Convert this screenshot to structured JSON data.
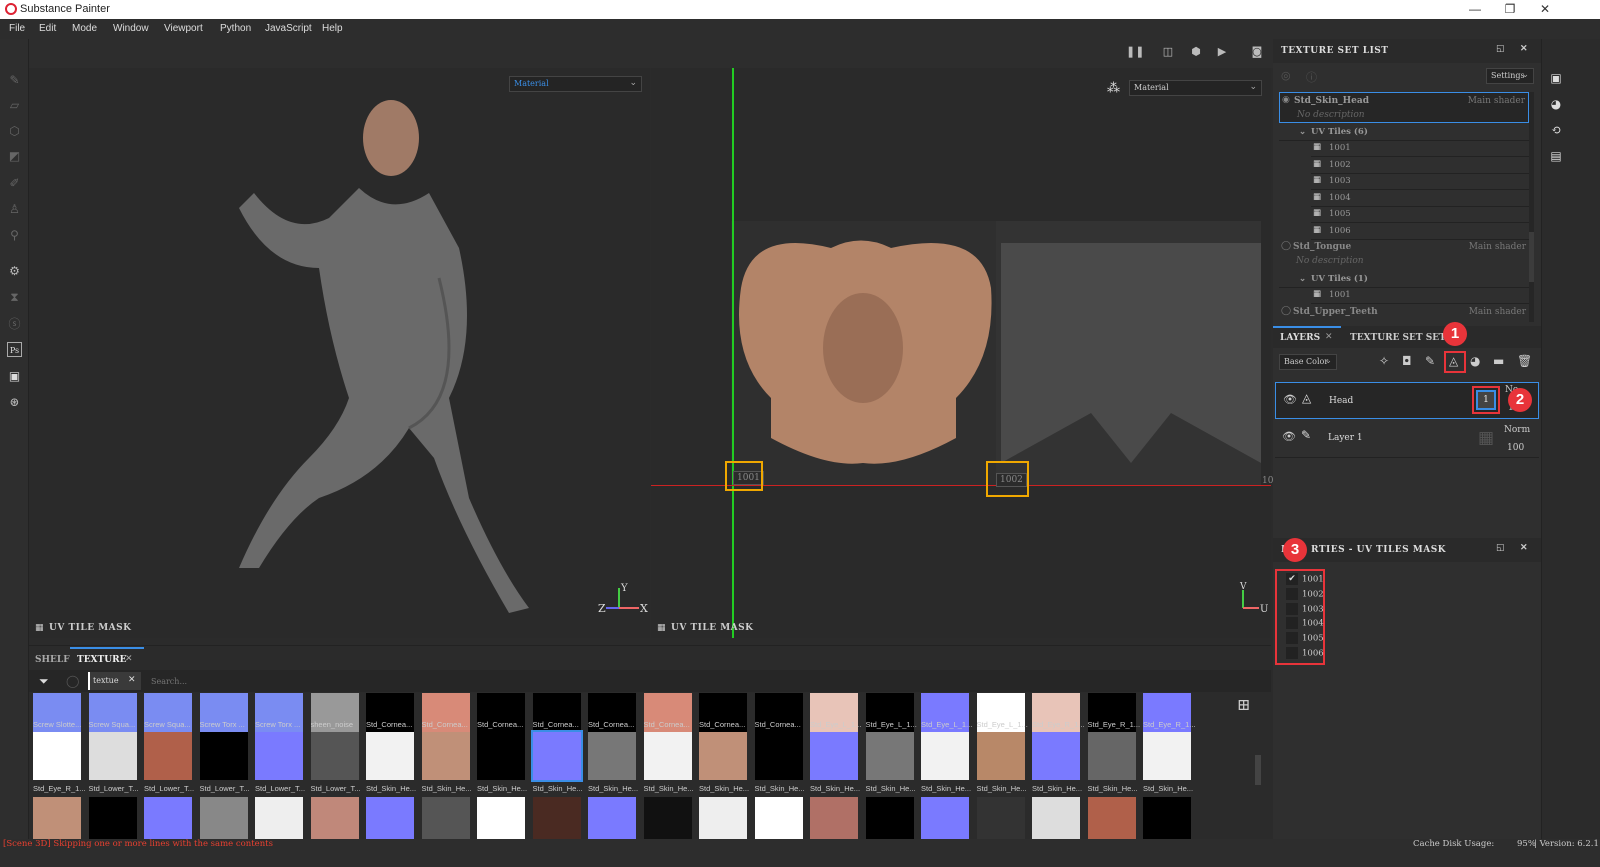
{
  "app": {
    "title": "Substance Painter"
  },
  "window_controls": {
    "minimize": "—",
    "restore": "❐",
    "close": "✕"
  },
  "menu": [
    "File",
    "Edit",
    "Mode",
    "Window",
    "Viewport",
    "Python",
    "JavaScript",
    "Help"
  ],
  "left_tools": [
    "paint-brush",
    "eraser",
    "projection",
    "polygon-fill",
    "smudge",
    "clone-stamp",
    "color-picker",
    "bake",
    "hourglass",
    "substance",
    "photoshop",
    "export",
    "plugin"
  ],
  "viewport_3d": {
    "dropdown_value": "Material",
    "axis_labels": {
      "x": "X",
      "y": "Y",
      "z": "Z"
    },
    "bottom_label": "UV TILE MASK"
  },
  "viewport_2d": {
    "dropdown_value": "Material",
    "tile_labels": [
      "1001",
      "1002"
    ],
    "axis_labels": {
      "u": "U",
      "v": "V"
    },
    "bottom_label": "UV TILE MASK",
    "edge_label": "10"
  },
  "texture_set_list": {
    "title": "TEXTURE SET LIST",
    "settings_label": "Settings",
    "sets": [
      {
        "name": "Std_Skin_Head",
        "shader": "Main shader",
        "description": "No description",
        "uv_header": "UV Tiles (6)",
        "tiles": [
          "1001",
          "1002",
          "1003",
          "1004",
          "1005",
          "1006"
        ],
        "selected": true
      },
      {
        "name": "Std_Tongue",
        "shader": "Main shader",
        "description": "No description",
        "uv_header": "UV Tiles (1)",
        "tiles": [
          "1001"
        ]
      },
      {
        "name": "Std_Upper_Teeth",
        "shader": "Main shader"
      }
    ]
  },
  "layers_panel": {
    "tabs": [
      "LAYERS",
      "TEXTURE SET SETTI"
    ],
    "channel": "Base Color",
    "layers": [
      {
        "name": "Head",
        "blend": "No",
        "opacity": "10",
        "mask_number": "1",
        "selected": true
      },
      {
        "name": "Layer 1",
        "blend": "Norm",
        "opacity": "100"
      }
    ]
  },
  "properties_panel": {
    "title": "PROPERTIES - UV TILES MASK",
    "title_visible": "RTIES - UV TILES MASK",
    "title_prefix": "P",
    "tiles": [
      {
        "label": "1001",
        "checked": true
      },
      {
        "label": "1002",
        "checked": false
      },
      {
        "label": "1003",
        "checked": false
      },
      {
        "label": "1004",
        "checked": false
      },
      {
        "label": "1005",
        "checked": false
      },
      {
        "label": "1006",
        "checked": false
      }
    ]
  },
  "annotations": [
    "1",
    "2",
    "3"
  ],
  "shelf": {
    "tabs": [
      "SHELF",
      "TEXTURE"
    ],
    "filter_tag": "textue",
    "search_placeholder": "Search...",
    "row1": [
      {
        "name": "Screw Slotte...",
        "color": "#7a8cf2"
      },
      {
        "name": "Screw Squa...",
        "color": "#7a8cf2"
      },
      {
        "name": "Screw Squa...",
        "color": "#7a8cf2"
      },
      {
        "name": "Screw Torx ...",
        "color": "#7a8cf2"
      },
      {
        "name": "Screw Torx ...",
        "color": "#7a8cf2"
      },
      {
        "name": "sheen_noise",
        "color": "#999999"
      },
      {
        "name": "Std_Cornea...",
        "color": "#000000"
      },
      {
        "name": "Std_Cornea...",
        "color": "#d88a78"
      },
      {
        "name": "Std_Cornea...",
        "color": "#000000"
      },
      {
        "name": "Std_Cornea...",
        "color": "#000000"
      },
      {
        "name": "Std_Cornea...",
        "color": "#000000"
      },
      {
        "name": "Std_Cornea...",
        "color": "#d88a78"
      },
      {
        "name": "Std_Cornea...",
        "color": "#000000"
      },
      {
        "name": "Std_Cornea...",
        "color": "#000000"
      },
      {
        "name": "Std_Eye_L_1...",
        "color": "#e8c4b8"
      },
      {
        "name": "Std_Eye_L_1...",
        "color": "#000000"
      },
      {
        "name": "Std_Eye_L_1...",
        "color": "#7a7aff"
      },
      {
        "name": "Std_Eye_L_1...",
        "color": "#ffffff"
      },
      {
        "name": "Std_Eye_R_1...",
        "color": "#e8c4b8"
      },
      {
        "name": "Std_Eye_R_1...",
        "color": "#000000"
      },
      {
        "name": "Std_Eye_R_1...",
        "color": "#7a7aff"
      }
    ],
    "row2": [
      {
        "name": "Std_Eye_R_1...",
        "color": "#ffffff"
      },
      {
        "name": "Std_Lower_T...",
        "color": "#dddddd"
      },
      {
        "name": "Std_Lower_T...",
        "color": "#b0604a"
      },
      {
        "name": "Std_Lower_T...",
        "color": "#000000"
      },
      {
        "name": "Std_Lower_T...",
        "color": "#7a7aff"
      },
      {
        "name": "Std_Lower_T...",
        "color": "#555555"
      },
      {
        "name": "Std_Skin_He...",
        "color": "#f2f2f2"
      },
      {
        "name": "Std_Skin_He...",
        "color": "#c09078"
      },
      {
        "name": "Std_Skin_He...",
        "color": "#000000"
      },
      {
        "name": "Std_Skin_He...",
        "color": "#7a7aff",
        "selected": true
      },
      {
        "name": "Std_Skin_He...",
        "color": "#777777"
      },
      {
        "name": "Std_Skin_He...",
        "color": "#f2f2f2"
      },
      {
        "name": "Std_Skin_He...",
        "color": "#c09078"
      },
      {
        "name": "Std_Skin_He...",
        "color": "#000000"
      },
      {
        "name": "Std_Skin_He...",
        "color": "#7a7aff"
      },
      {
        "name": "Std_Skin_He...",
        "color": "#777777"
      },
      {
        "name": "Std_Skin_He...",
        "color": "#f2f2f2"
      },
      {
        "name": "Std_Skin_He...",
        "color": "#b88868"
      },
      {
        "name": "Std_Skin_He...",
        "color": "#7a7aff"
      },
      {
        "name": "Std_Skin_He...",
        "color": "#666666"
      },
      {
        "name": "Std_Skin_He...",
        "color": "#f2f2f2"
      }
    ],
    "row3_colors": [
      "#c09078",
      "#000000",
      "#7a7aff",
      "#888888",
      "#eeeeee",
      "#c0887a",
      "#7a7aff",
      "#555555",
      "#ffffff",
      "#4a2a22",
      "#7a7aff",
      "#111111",
      "#eeeeee",
      "#ffffff",
      "#b07066",
      "#000000",
      "#7a7aff",
      "#333333",
      "#dddddd",
      "#b0604a",
      "#000000"
    ]
  },
  "status": {
    "message": "[Scene 3D] Skipping one or more lines with the same contents",
    "cache": "Cache Disk Usage:",
    "cache_value": "95%",
    "version": "| Version: 6.2.1"
  },
  "colors": {
    "accent": "#3a8ee6",
    "highlight_yellow": "#f0a800",
    "highlight_red": "#e8343a",
    "status_error": "#e84030"
  }
}
